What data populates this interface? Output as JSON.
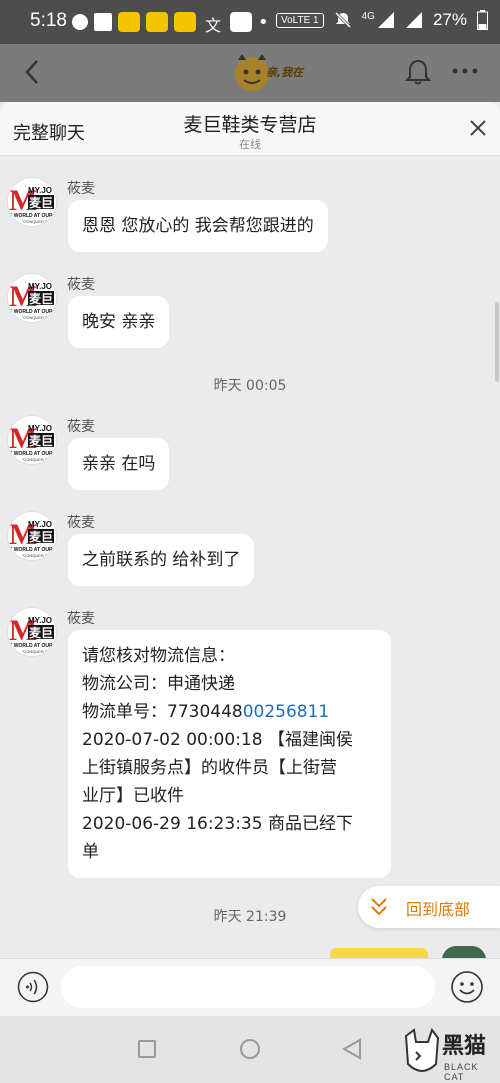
{
  "status_bar": {
    "time": "5:18",
    "volte": "VoLTE 1",
    "network": "4G",
    "battery": "27%"
  },
  "app_header": {
    "logo_text": "亲,我在"
  },
  "chat_header": {
    "full_chat_label": "完整聊天",
    "shop_name": "麦巨鞋类专营店",
    "status": "在线"
  },
  "avatar_brand": {
    "text_top": "MY.JO",
    "text_main": "麦巨",
    "tagline": "E WORLD AT OUR F",
    "sub": "\"CONQUER THE WO\""
  },
  "messages": [
    {
      "sender": "莜麦",
      "text": "恩恩  您放心的  我会帮您跟进的"
    },
    {
      "sender": "莜麦",
      "text": "晚安 亲亲"
    },
    {
      "timestamp": "昨天  00:05"
    },
    {
      "sender": "莜麦",
      "text": "亲亲 在吗"
    },
    {
      "sender": "莜麦",
      "text": "之前联系的 给补到了"
    },
    {
      "sender": "莜麦",
      "lines": {
        "l1": "请您核对物流信息：",
        "l2": "物流公司：申通快递",
        "l3_prefix": "物流单号：7730448",
        "l3_link": "00256811",
        "l4": "2020-07-02 00:00:18 【福建闽侯",
        "l5": "上街镇服务点】的收件员【上街营",
        "l6": "业厅】已收件",
        "l7": "2020-06-29 16:23:35 商品已经下",
        "l8": "单"
      }
    },
    {
      "timestamp": "昨天  21:39"
    }
  ],
  "back_to_bottom": "回到底部",
  "input": {
    "placeholder": ""
  },
  "watermark": {
    "text": "黑猫",
    "sub": "BLACK CAT"
  },
  "colors": {
    "accent": "#e07a10",
    "link": "#1a6dbd",
    "avatar_red": "#d9262c"
  }
}
